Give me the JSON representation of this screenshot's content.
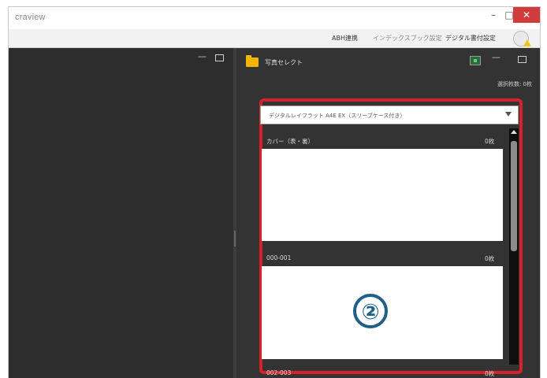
{
  "window": {
    "title": "craview",
    "controls": {
      "minimize": "–",
      "maximize": "□",
      "close": "✕"
    }
  },
  "menu": {
    "items": [
      "ABH連携",
      "インデックスブック設定",
      "デジタル書付設定"
    ],
    "help_icon": "help-warning-icon"
  },
  "left_pane": {
    "controls": {
      "minimize": "—",
      "maximize": "□"
    }
  },
  "right_pane": {
    "title": "写真セレクト",
    "controls": {
      "minimize": "—",
      "maximize": "□"
    },
    "selected_count": "選択枚数: 0枚",
    "product_select": {
      "value": "デジタルレイフラット A4E EX（スリーブケース付き）"
    },
    "pages": [
      {
        "label": "カバー（表・裏）",
        "count": "0枚"
      },
      {
        "label": "000-001",
        "count": "0枚"
      },
      {
        "label": "002-003",
        "count": "0枚"
      }
    ],
    "callout_number": "②"
  },
  "colors": {
    "highlight": "#d6202a",
    "dark_panel": "#333333",
    "folder": "#f5b400",
    "callout": "#1f5f88"
  }
}
